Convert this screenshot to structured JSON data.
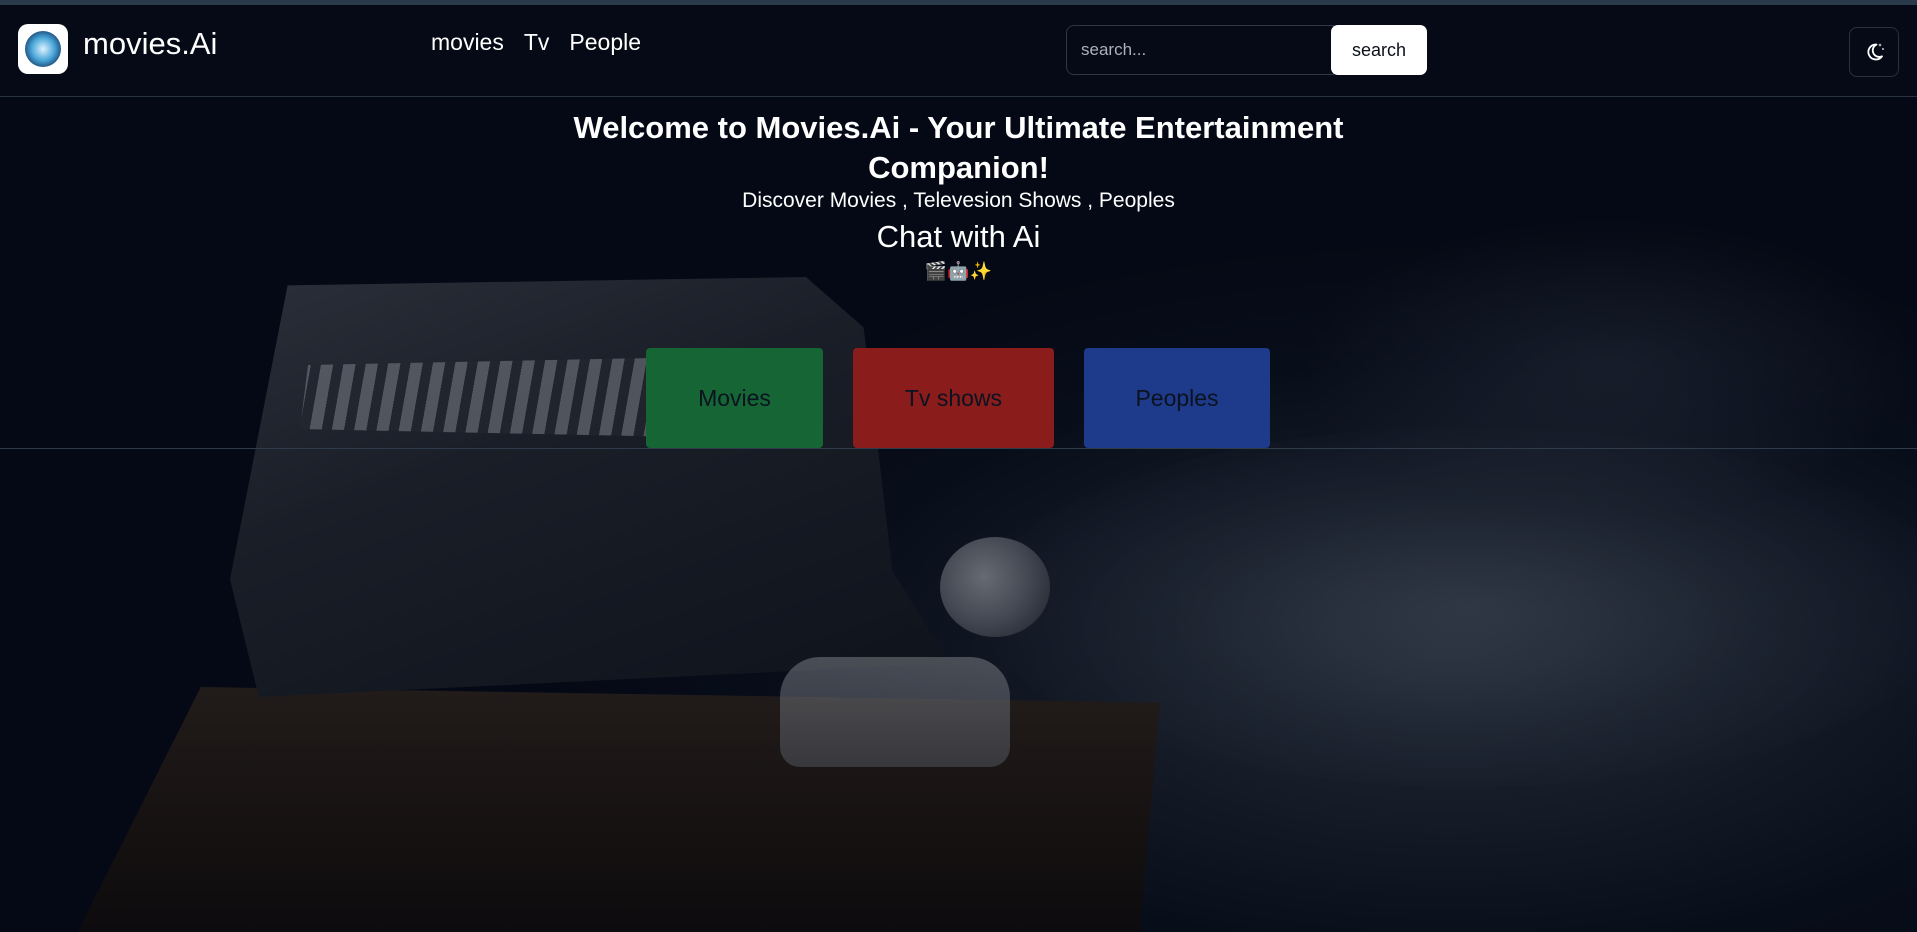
{
  "app": {
    "brand": "movies.Ai"
  },
  "nav": {
    "links": [
      "movies",
      "Tv",
      "People"
    ]
  },
  "search": {
    "placeholder": "search...",
    "button_label": "search"
  },
  "hero": {
    "title": "Welcome to Movies.Ai - Your Ultimate Entertainment Companion!",
    "subtitle": "Discover Movies , Televesion Shows , Peoples",
    "chat": "Chat with Ai",
    "emojis": "🎬🤖✨"
  },
  "categories": {
    "movies": {
      "label": "Movies",
      "color": "#166534"
    },
    "tv": {
      "label": "Tv shows",
      "color": "#8b1c1c"
    },
    "people": {
      "label": "Peoples",
      "color": "#1e3a8a"
    }
  },
  "icons": {
    "logo": "movies-ai-logo-icon",
    "theme": "moon-stars-icon"
  }
}
